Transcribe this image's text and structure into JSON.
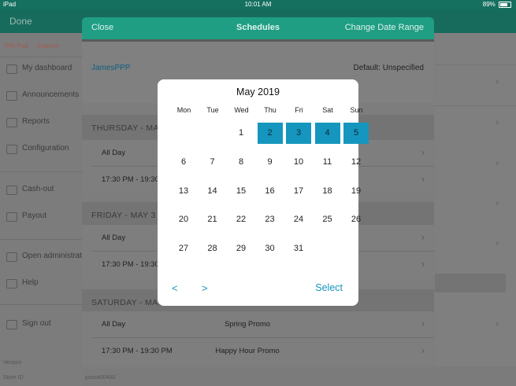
{
  "status_bar": {
    "device": "iPad",
    "time": "10:01 AM",
    "battery": "89%"
  },
  "app_bar": {
    "done_label": "Done"
  },
  "sidebar": {
    "top_links": [
      "PIN Pad",
      "Scanner"
    ],
    "items": [
      {
        "label": "My dashboard"
      },
      {
        "label": "Announcements"
      },
      {
        "label": "Reports"
      },
      {
        "label": "Configuration"
      },
      {
        "label": "Cash-out"
      },
      {
        "label": "Payout"
      },
      {
        "label": "Open administrati"
      },
      {
        "label": "Help"
      },
      {
        "label": "Sign out"
      }
    ],
    "footer": {
      "version_label": "Version",
      "store_label": "Store ID",
      "store_value": "posca00400"
    }
  },
  "modal": {
    "close_label": "Close",
    "title": "Schedules",
    "change_range_label": "Change Date Range",
    "user": "JamesPPP",
    "default_text": "Default: Unspecified",
    "sections": [
      {
        "header": "THURSDAY - MA",
        "rows": [
          {
            "time": "All Day",
            "promo": ""
          },
          {
            "time": "17:30 PM - 19:30",
            "promo": ""
          }
        ]
      },
      {
        "header": "FRIDAY - MAY 3",
        "rows": [
          {
            "time": "All Day",
            "promo": ""
          },
          {
            "time": "17:30 PM - 19:30",
            "promo": ""
          }
        ]
      },
      {
        "header": "SATURDAY - MAY",
        "rows": [
          {
            "time": "All Day",
            "promo": "Spring Promo"
          },
          {
            "time": "17:30 PM - 19:30 PM",
            "promo": "Happy Hour Promo"
          }
        ]
      }
    ]
  },
  "calendar": {
    "month_label": "May 2019",
    "weekdays": [
      "Mon",
      "Tue",
      "Wed",
      "Thu",
      "Fri",
      "Sat",
      "Sun"
    ],
    "weeks": [
      [
        "",
        "",
        "1",
        "2",
        "3",
        "4",
        "5"
      ],
      [
        "6",
        "7",
        "8",
        "9",
        "10",
        "11",
        "12"
      ],
      [
        "13",
        "14",
        "15",
        "16",
        "17",
        "18",
        "19"
      ],
      [
        "20",
        "21",
        "22",
        "23",
        "24",
        "25",
        "26"
      ],
      [
        "27",
        "28",
        "29",
        "30",
        "31",
        "",
        ""
      ]
    ],
    "selected_days": [
      "2",
      "3",
      "4",
      "5"
    ],
    "prev_label": "<",
    "next_label": ">",
    "select_label": "Select",
    "accent_color": "#1596be"
  }
}
